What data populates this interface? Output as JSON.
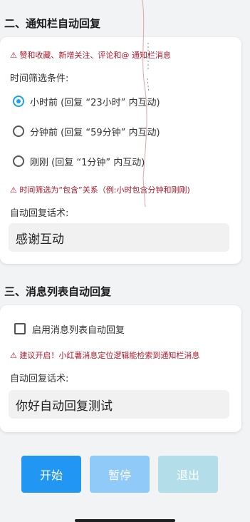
{
  "section2": {
    "title": "二、通知栏自动回复",
    "warning": "⚠ 赞和收藏、新增关注、评论和@ 通知栏消息",
    "filter_label": "时间筛选条件:",
    "options": [
      {
        "label": "小时前 (回复 “23小时” 内互动)",
        "checked": true
      },
      {
        "label": "分钟前 (回复 “59分钟” 内互动)",
        "checked": false
      },
      {
        "label": "刚刚 (回复 “1分钟” 内互动)",
        "checked": false
      }
    ],
    "filter_note": "⚠ 时间筛选为“包含”关系（例:小时包含分钟和刚刚)",
    "reply_label": "自动回复话术:",
    "reply_value": "感谢互动"
  },
  "section3": {
    "title": "三、消息列表自动回复",
    "checkbox_label": "启用消息列表自动回复",
    "checkbox_checked": false,
    "warning": "⚠ 建议开启！小红薯消息定位逻辑能检索到通知栏消息",
    "reply_label": "自动回复话术:",
    "reply_value": "你好自动回复测试"
  },
  "buttons": {
    "start": "开始",
    "pause": "暂停",
    "exit": "退出"
  },
  "colors": {
    "accent": "#1aa3e8",
    "start_bg": "#2196f3",
    "pause_bg": "#90caf9",
    "exit_bg": "#b3dde8",
    "warning": "#b0182a"
  }
}
